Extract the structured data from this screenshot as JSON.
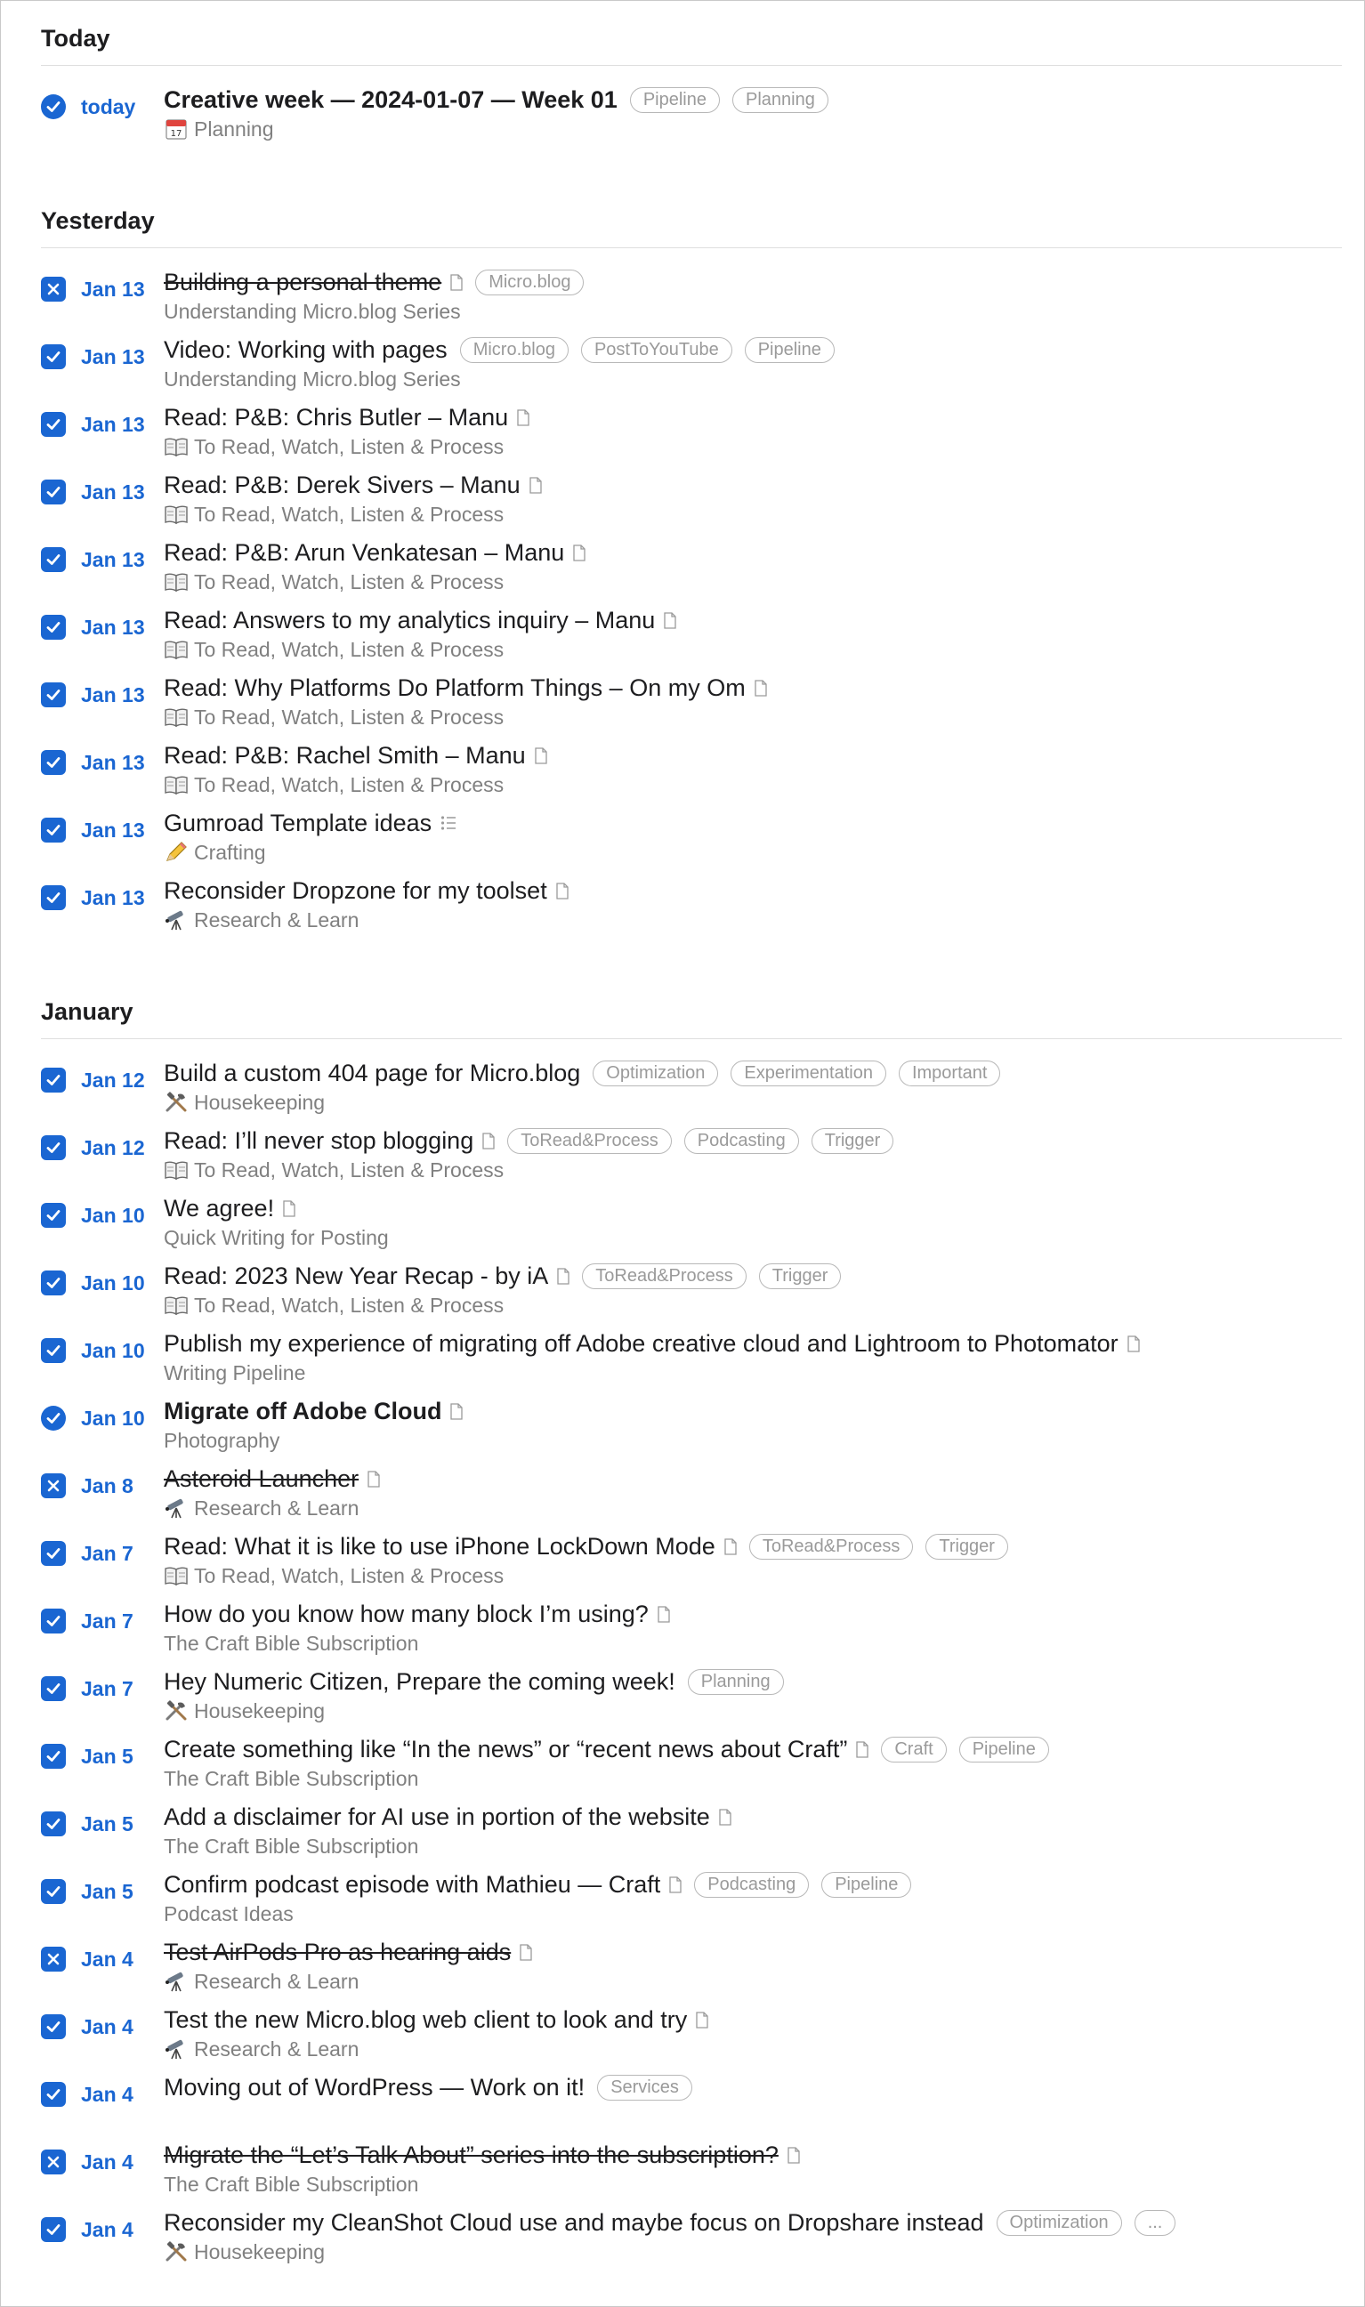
{
  "sections": [
    {
      "heading": "Today",
      "items": [
        {
          "date": "today",
          "check": "circle",
          "title": "Creative week — 2024-01-07 — Week 01",
          "bold": true,
          "doc": false,
          "tags": [
            "Pipeline",
            "Planning"
          ],
          "emoji": "calendar-icon",
          "subtitle": "Planning"
        }
      ]
    },
    {
      "heading": "Yesterday",
      "items": [
        {
          "date": "Jan 13",
          "check": "cancel",
          "title": "Building a personal theme",
          "strike": true,
          "doc": true,
          "tags": [
            "Micro.blog"
          ],
          "subtitle": "Understanding Micro.blog Series"
        },
        {
          "date": "Jan 13",
          "check": "done",
          "title": "Video: Working with pages",
          "doc": false,
          "tags": [
            "Micro.blog",
            "PostToYouTube",
            "Pipeline"
          ],
          "subtitle": "Understanding Micro.blog Series"
        },
        {
          "date": "Jan 13",
          "check": "done",
          "title": "Read: P&B: Chris Butler – Manu",
          "doc": true,
          "tags": [],
          "emoji": "book-icon",
          "subtitle": "To Read, Watch, Listen & Process"
        },
        {
          "date": "Jan 13",
          "check": "done",
          "title": "Read: P&B: Derek Sivers – Manu",
          "doc": true,
          "tags": [],
          "emoji": "book-icon",
          "subtitle": "To Read, Watch, Listen & Process"
        },
        {
          "date": "Jan 13",
          "check": "done",
          "title": "Read: P&B: Arun Venkatesan – Manu",
          "doc": true,
          "tags": [],
          "emoji": "book-icon",
          "subtitle": "To Read, Watch, Listen & Process"
        },
        {
          "date": "Jan 13",
          "check": "done",
          "title": "Read: Answers to my analytics inquiry – Manu",
          "doc": true,
          "tags": [],
          "emoji": "book-icon",
          "subtitle": "To Read, Watch, Listen & Process"
        },
        {
          "date": "Jan 13",
          "check": "done",
          "title": "Read: Why Platforms Do Platform Things – On my Om",
          "doc": true,
          "tags": [],
          "emoji": "book-icon",
          "subtitle": "To Read, Watch, Listen & Process"
        },
        {
          "date": "Jan 13",
          "check": "done",
          "title": "Read: P&B: Rachel Smith – Manu",
          "doc": true,
          "tags": [],
          "emoji": "book-icon",
          "subtitle": "To Read, Watch, Listen & Process"
        },
        {
          "date": "Jan 13",
          "check": "done",
          "title": "Gumroad Template ideas",
          "list": true,
          "tags": [],
          "emoji": "pencil-icon",
          "subtitle": "Crafting"
        },
        {
          "date": "Jan 13",
          "check": "done",
          "title": "Reconsider Dropzone for my toolset",
          "doc": true,
          "tags": [],
          "emoji": "telescope-icon",
          "subtitle": "Research & Learn"
        }
      ]
    },
    {
      "heading": "January",
      "items": [
        {
          "date": "Jan 12",
          "check": "done",
          "title": "Build a custom 404 page for Micro.blog",
          "doc": false,
          "tags": [
            "Optimization",
            "Experimentation",
            "Important"
          ],
          "emoji": "tools-icon",
          "subtitle": "Housekeeping"
        },
        {
          "date": "Jan 12",
          "check": "done",
          "title": "Read: I’ll never stop blogging",
          "doc": true,
          "tags": [
            "ToRead&Process",
            "Podcasting",
            "Trigger"
          ],
          "emoji": "book-icon",
          "subtitle": "To Read, Watch, Listen & Process"
        },
        {
          "date": "Jan 10",
          "check": "done",
          "title": "We agree!",
          "doc": true,
          "tags": [],
          "subtitle": "Quick Writing for Posting"
        },
        {
          "date": "Jan 10",
          "check": "done",
          "title": "Read: 2023 New Year Recap - by iA",
          "doc": true,
          "tags": [
            "ToRead&Process",
            "Trigger"
          ],
          "emoji": "book-icon",
          "subtitle": "To Read, Watch, Listen & Process"
        },
        {
          "date": "Jan 10",
          "check": "done",
          "title": "Publish my experience of migrating off Adobe creative cloud and Lightroom to Photomator",
          "doc": true,
          "tags": [],
          "subtitle": "Writing Pipeline"
        },
        {
          "date": "Jan 10",
          "check": "circle",
          "title": "Migrate off Adobe Cloud",
          "bold": true,
          "doc": true,
          "tags": [],
          "subtitle": "Photography"
        },
        {
          "date": "Jan 8",
          "check": "cancel",
          "title": "Asteroid Launcher",
          "strike": true,
          "doc": true,
          "tags": [],
          "emoji": "telescope-icon",
          "subtitle": "Research & Learn"
        },
        {
          "date": "Jan 7",
          "check": "done",
          "title": "Read: What it is like to use iPhone LockDown Mode",
          "doc": true,
          "tags": [
            "ToRead&Process",
            "Trigger"
          ],
          "emoji": "book-icon",
          "subtitle": "To Read, Watch, Listen & Process"
        },
        {
          "date": "Jan 7",
          "check": "done",
          "title": "How do you know how many block I’m using?",
          "doc": true,
          "tags": [],
          "subtitle": "The Craft Bible Subscription"
        },
        {
          "date": "Jan 7",
          "check": "done",
          "title": "Hey Numeric Citizen, Prepare the coming week!",
          "doc": false,
          "tags": [
            "Planning"
          ],
          "emoji": "tools-icon",
          "subtitle": "Housekeeping"
        },
        {
          "date": "Jan 5",
          "check": "done",
          "title": "Create something like “In the news” or “recent news about Craft”",
          "doc": true,
          "tags": [
            "Craft",
            "Pipeline"
          ],
          "subtitle": "The Craft Bible Subscription"
        },
        {
          "date": "Jan 5",
          "check": "done",
          "title": "Add a disclaimer for AI use in portion of the website",
          "doc": true,
          "tags": [],
          "subtitle": "The Craft Bible Subscription"
        },
        {
          "date": "Jan 5",
          "check": "done",
          "title": "Confirm podcast episode with Mathieu — Craft",
          "doc": true,
          "tags": [
            "Podcasting",
            "Pipeline"
          ],
          "subtitle": "Podcast Ideas"
        },
        {
          "date": "Jan 4",
          "check": "cancel",
          "title": "Test AirPods Pro as hearing aids",
          "strike": true,
          "doc": true,
          "tags": [],
          "emoji": "telescope-icon",
          "subtitle": "Research & Learn"
        },
        {
          "date": "Jan 4",
          "check": "done",
          "title": "Test the new Micro.blog web client to look and try",
          "doc": true,
          "tags": [],
          "emoji": "telescope-icon",
          "subtitle": "Research & Learn"
        },
        {
          "date": "Jan 4",
          "check": "done",
          "title": "Moving out of WordPress — Work on it!",
          "doc": false,
          "tags": [
            "Services"
          ],
          "subtitle": ""
        },
        {
          "date": "Jan 4",
          "check": "cancel",
          "title": "Migrate the “Let’s Talk About” series into the subscription?",
          "strike": true,
          "doc": true,
          "tags": [],
          "subtitle": "The Craft Bible Subscription"
        },
        {
          "date": "Jan 4",
          "check": "done",
          "title": "Reconsider my CleanShot Cloud use and maybe focus on Dropshare instead",
          "doc": false,
          "tags": [
            "Optimization",
            "..."
          ],
          "emoji": "tools-icon",
          "subtitle": "Housekeeping"
        }
      ]
    }
  ],
  "colors": {
    "accent": "#1a66d2",
    "muted": "#808080",
    "tag": "#9a9a9a"
  }
}
